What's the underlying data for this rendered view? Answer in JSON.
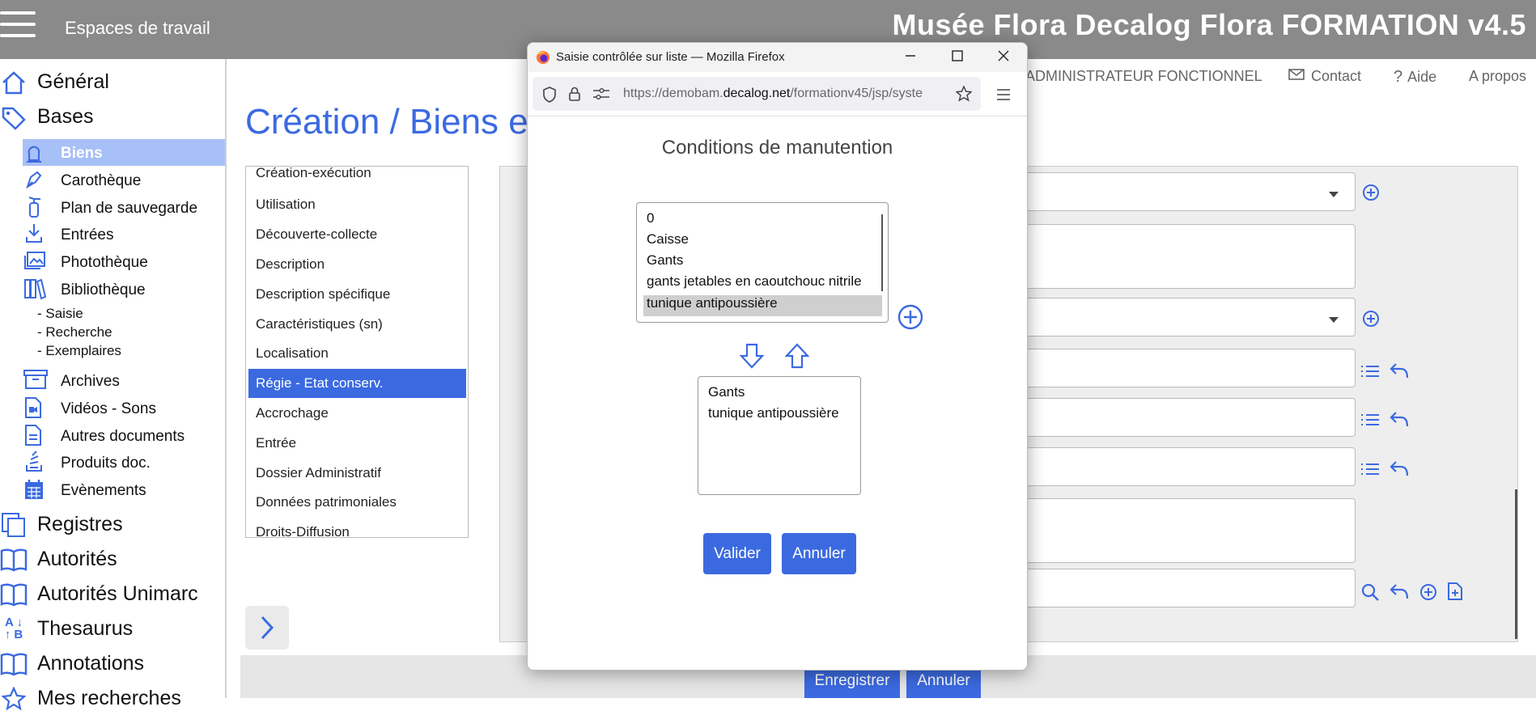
{
  "header": {
    "workspaces": "Espaces de travail",
    "app_title": "Musée Flora Decalog Flora FORMATION v4.5"
  },
  "top_links": {
    "role": "ADMINISTRATEUR FONCTIONNEL",
    "contact": "Contact",
    "help": "Aide",
    "about": "A propos"
  },
  "sidebar": {
    "general": "Général",
    "bases": "Bases",
    "biens": "Biens",
    "carotheque": "Carothèque",
    "plan": "Plan de sauvegarde",
    "entrees": "Entrées",
    "phototheque": "Photothèque",
    "bibliotheque": "Bibliothèque",
    "saisie": "- Saisie",
    "recherche": "- Recherche",
    "exemplaires": "- Exemplaires",
    "archives": "Archives",
    "videos": "Vidéos - Sons",
    "autres": "Autres documents",
    "produits": "Produits doc.",
    "evenements": "Evènements",
    "registres": "Registres",
    "autorites": "Autorités",
    "autorites_unimarc": "Autorités Unimarc",
    "thesaurus": "Thesaurus",
    "annotations": "Annotations",
    "mes_recherches": "Mes recherches"
  },
  "page": {
    "title": "Création / Biens e"
  },
  "tabs": [
    "Création-exécution",
    "Utilisation",
    "Découverte-collecte",
    "Description",
    "Description spécifique",
    "Caractéristiques (sn)",
    "Localisation",
    "Régie - Etat conserv.",
    "Accrochage",
    "Entrée",
    "Dossier Administratif",
    "Données patrimoniales",
    "Droits-Diffusion"
  ],
  "active_tab": "Régie - Etat conserv.",
  "bottom": {
    "save": "Enregistrer",
    "cancel": "Annuler"
  },
  "dialog": {
    "window_title": "Saisie contrôlée sur liste — Mozilla Firefox",
    "url_prefix": "https://demobam.",
    "url_domain": "decalog.net",
    "url_suffix": "/formationv45/jsp/syste",
    "heading": "Conditions de manutention",
    "available_options": [
      "0",
      "Caisse",
      "Gants",
      "gants jetables en caoutchouc nitrile",
      "tunique antipoussière"
    ],
    "selected_option": "tunique antipoussière",
    "chosen_values": [
      "Gants",
      "tunique antipoussière"
    ],
    "validate": "Valider",
    "cancel": "Annuler"
  },
  "colors": {
    "accent": "#3b6ae0",
    "topbar": "#8a8a8a",
    "sidebar_active": "#a8c0f8"
  }
}
